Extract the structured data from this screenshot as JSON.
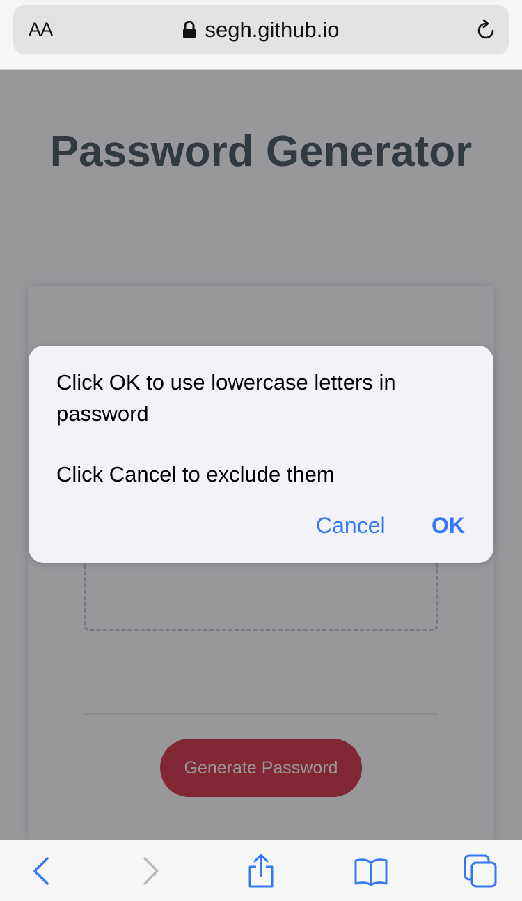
{
  "browser": {
    "reader_label": "AA",
    "url": "segh.github.io",
    "icons": {
      "lock": "lock-icon",
      "reload": "reload-icon",
      "back": "chevron-left-icon",
      "forward": "chevron-right-icon",
      "share": "share-icon",
      "bookmarks": "book-icon",
      "tabs": "tabs-icon"
    },
    "accent_color": "#3478f6"
  },
  "page": {
    "title": "Password Generator",
    "generate_button_label": "Generate Password",
    "button_color": "#d4283f"
  },
  "dialog": {
    "message_line1": "Click OK to use lowercase letters in password",
    "message_line2": "Click Cancel to exclude them",
    "cancel_label": "Cancel",
    "ok_label": "OK"
  }
}
